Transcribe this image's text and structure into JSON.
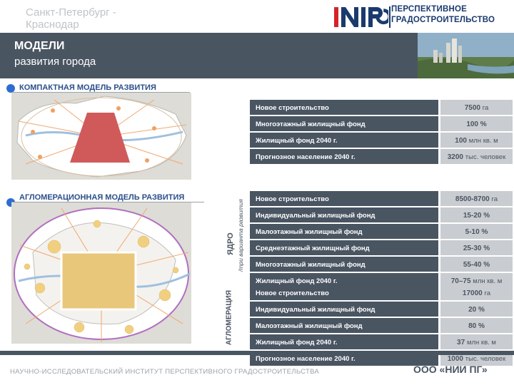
{
  "header": {
    "city": "Санкт-Петербург - Краснодар",
    "title": "МОДЕЛИ",
    "subtitle": "развития города",
    "logo_mark": "NIPG",
    "logo_text_line1": "ПЕРСПЕКТИВНОЕ",
    "logo_text_line2": "ГРАДОСТРОИТЕЛЬСТВО"
  },
  "compact": {
    "heading": "КОМПАКТНАЯ МОДЕЛЬ РАЗВИТИЯ",
    "rows": [
      {
        "label": "Новое строительство",
        "value": "7500",
        "unit": "га"
      },
      {
        "label": "Многоэтажный жилищный фонд",
        "value": "100 %",
        "unit": ""
      },
      {
        "label": "Жилищный фонд 2040 г.",
        "value": "100",
        "unit": "млн кв. м"
      },
      {
        "label": "Прогнозное население 2040 г.",
        "value": "3200",
        "unit": "тыс. человек"
      }
    ]
  },
  "agglomeration": {
    "heading": "АГЛОМЕРАЦИОННАЯ МОДЕЛЬ РАЗВИТИЯ",
    "core_label": "ЯДРО",
    "core_sub": "/три варианта развития",
    "agg_label": "АГЛОМЕРАЦИЯ",
    "core_rows": [
      {
        "label": "Новое строительство",
        "value": "8500-8700",
        "unit": "га"
      },
      {
        "label": "Индивидуальный жилищный фонд",
        "value": "15-20 %",
        "unit": ""
      },
      {
        "label": "Малоэтажный жилищный фонд",
        "value": "5-10 %",
        "unit": ""
      },
      {
        "label": "Среднеэтажный жилищный фонд",
        "value": "25-30 %",
        "unit": ""
      },
      {
        "label": "Многоэтажный жилищный фонд",
        "value": "55-40 %",
        "unit": ""
      },
      {
        "label": "Жилищный фонд 2040 г.",
        "value": "70–75",
        "unit": "млн кв. м"
      }
    ],
    "agg_rows": [
      {
        "label": "Новое строительство",
        "value": "17000",
        "unit": "га"
      },
      {
        "label": "Индивидуальный жилищный фонд",
        "value": "20 %",
        "unit": ""
      },
      {
        "label": "Малоэтажный жилищный фонд",
        "value": "80 %",
        "unit": ""
      },
      {
        "label": "Жилищный фонд 2040 г.",
        "value": "37",
        "unit": "млн кв. м"
      },
      {
        "label": "Прогнозное население 2040 г.",
        "value": "1000",
        "unit": "тыс. человек"
      }
    ]
  },
  "footer": {
    "left": "НАУЧНО-ИССЛЕДОВАТЕЛЬСКИЙ ИНСТИТУТ ПЕРСПЕКТИВНОГО ГРАДОСТРОИТЕЛЬСТВА",
    "right": "ООО «НИИ ПГ»"
  },
  "colors": {
    "panel": "#4a5562",
    "value_bg": "#c9ccd0",
    "accent_blue": "#2e6dd0",
    "compact_triangle": "#d05a5a",
    "core_square": "#e8c77a"
  }
}
